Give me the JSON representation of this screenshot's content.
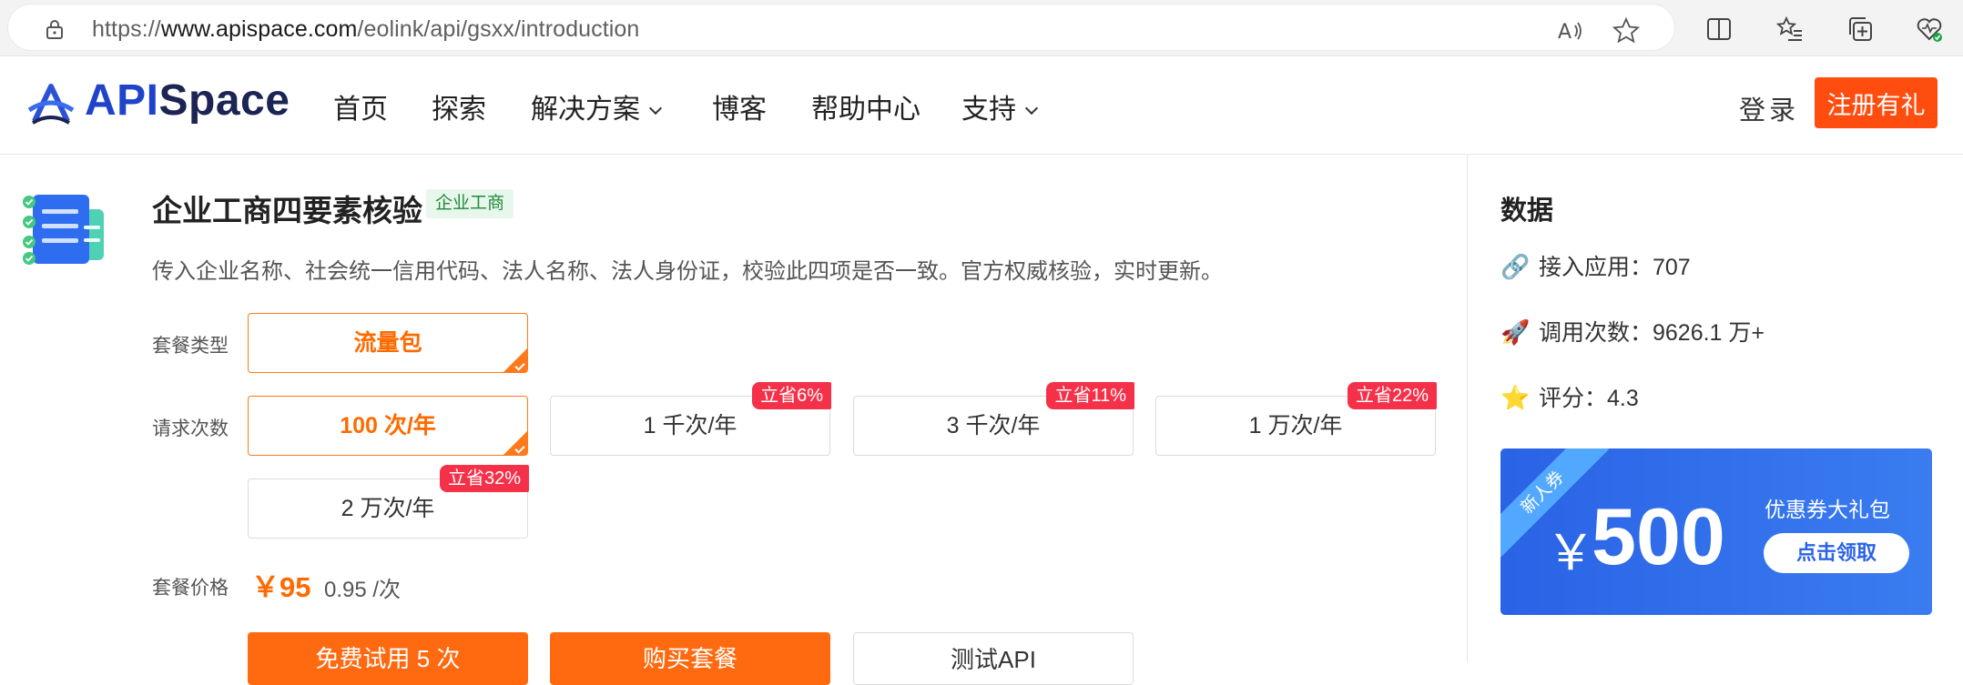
{
  "browser": {
    "url_prefix": "https://",
    "url_domain": "www.apispace.com",
    "url_path": "/eolink/api/gsxx/introduction"
  },
  "header": {
    "logo_api": "API",
    "logo_space": "Space",
    "nav": [
      {
        "label": "首页"
      },
      {
        "label": "探索"
      },
      {
        "label": "解决方案"
      },
      {
        "label": "博客"
      },
      {
        "label": "帮助中心"
      },
      {
        "label": "支持"
      }
    ],
    "login_label": "登录",
    "register_label": "注册有礼"
  },
  "product": {
    "title": "企业工商四要素核验",
    "category": "企业工商",
    "description": "传入企业名称、社会统一信用代码、法人名称、法人身份证，校验此四项是否一致。官方权威核验，实时更新。"
  },
  "package": {
    "type_label": "套餐类型",
    "type_option": "流量包",
    "count_label": "请求次数",
    "counts": [
      {
        "label": "100 次/年",
        "badge": ""
      },
      {
        "label": "1 千次/年",
        "badge": "立省6%"
      },
      {
        "label": "3 千次/年",
        "badge": "立省11%"
      },
      {
        "label": "1 万次/年",
        "badge": "立省22%"
      },
      {
        "label": "2 万次/年",
        "badge": "立省32%"
      }
    ],
    "price_label": "套餐价格",
    "price": "￥95",
    "unit_price": "0.95 /次"
  },
  "actions": {
    "trial": "免费试用 5 次",
    "buy": "购买套餐",
    "test": "测试API"
  },
  "sidebar": {
    "title": "数据",
    "stats": [
      {
        "label": "接入应用：707",
        "icon": "link-icon"
      },
      {
        "label": "调用次数：9626.1 万+",
        "icon": "rocket-icon"
      },
      {
        "label": "评分：4.3",
        "icon": "star-icon"
      }
    ],
    "coupon": {
      "ribbon": "新人券",
      "currency": "￥",
      "amount": "500",
      "title": "优惠券大礼包",
      "button": "点击领取"
    }
  },
  "colors": {
    "accent_orange": "#ff6a10",
    "brand_blue": "#1f43c9",
    "badge_red": "#f5314a",
    "coupon_blue": "#2a63e6"
  }
}
